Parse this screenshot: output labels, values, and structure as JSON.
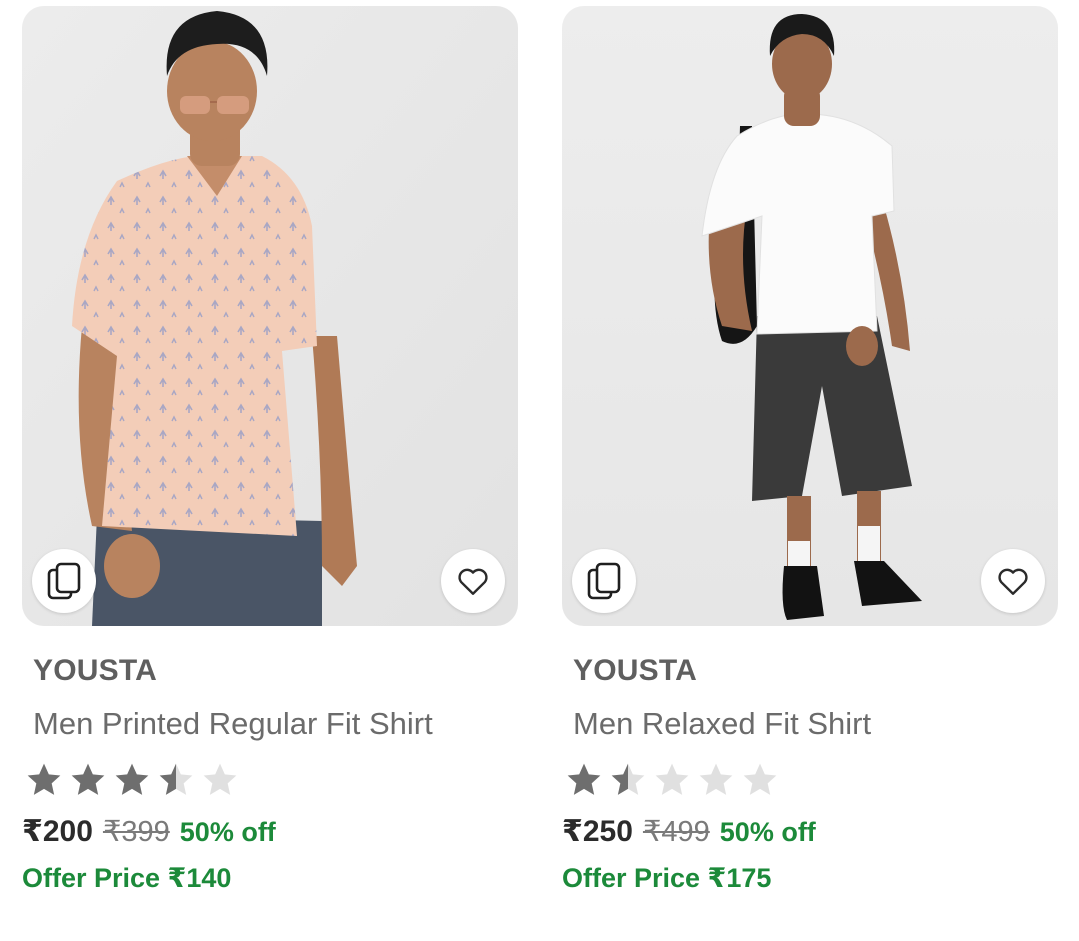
{
  "products": [
    {
      "brand": "YOUSTA",
      "title": "Men Printed Regular Fit Shirt",
      "rating": 3.5,
      "price": "₹200",
      "mrp": "₹399",
      "discount": "50% off",
      "offer_price": "Offer Price ₹140",
      "icons": [
        "similar-products-icon",
        "heart-icon"
      ]
    },
    {
      "brand": "YOUSTA",
      "title": "Men Relaxed Fit Shirt",
      "rating": 1.5,
      "price": "₹250",
      "mrp": "₹499",
      "discount": "50% off",
      "offer_price": "Offer Price ₹175",
      "icons": [
        "similar-products-icon",
        "heart-icon"
      ]
    }
  ],
  "colors": {
    "discount_green": "#1c8a3a",
    "star_filled": "#6e6e6e",
    "star_empty": "#e0e0e0"
  }
}
